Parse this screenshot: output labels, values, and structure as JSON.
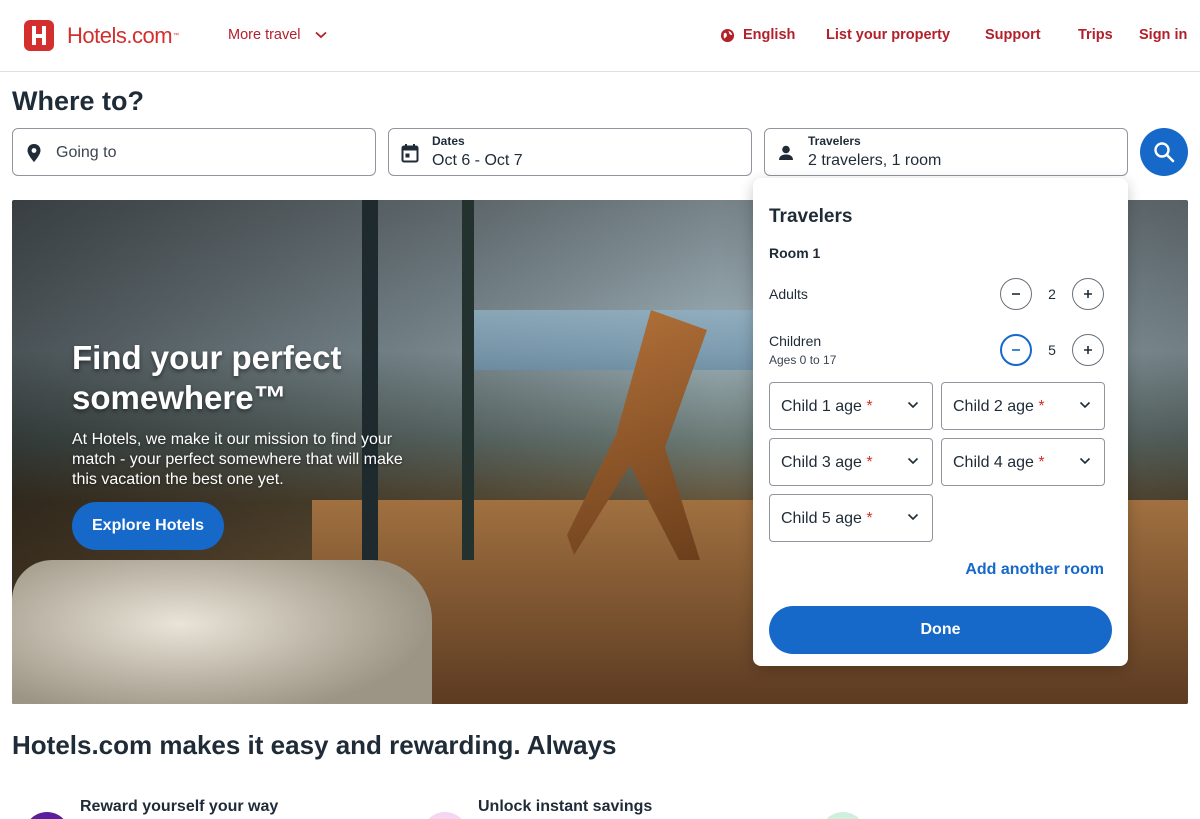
{
  "header": {
    "logo_text": "Hotels.com",
    "logo_tm": "™",
    "more_travel": "More travel",
    "language": "English",
    "list_property": "List your property",
    "support": "Support",
    "trips": "Trips",
    "sign_in": "Sign in"
  },
  "search": {
    "heading": "Where to?",
    "going_to_placeholder": "Going to",
    "dates_label": "Dates",
    "dates_value": "Oct 6 - Oct 7",
    "travelers_label": "Travelers",
    "travelers_value": "2 travelers, 1 room"
  },
  "hero": {
    "title": "Find your perfect somewhere™",
    "description": "At Hotels, we make it our mission to find your match - your perfect somewhere that will make this vacation the best one yet.",
    "button": "Explore Hotels"
  },
  "travelers_popup": {
    "title": "Travelers",
    "room_label": "Room 1",
    "adults_label": "Adults",
    "adults_count": "2",
    "children_label": "Children",
    "children_sublabel": "Ages 0 to 17",
    "children_count": "5",
    "child_ages": [
      {
        "label": "Child 1 age",
        "required": "*"
      },
      {
        "label": "Child 2 age",
        "required": "*"
      },
      {
        "label": "Child 3 age",
        "required": "*"
      },
      {
        "label": "Child 4 age",
        "required": "*"
      },
      {
        "label": "Child 5 age",
        "required": "*"
      }
    ],
    "add_room": "Add another room",
    "done": "Done"
  },
  "benefits": {
    "heading": "Hotels.com makes it easy and rewarding. Always",
    "items": [
      {
        "title": "Reward yourself your way",
        "color": "#5b1f9e"
      },
      {
        "title": "Unlock instant savings",
        "color": "#f4d6f0"
      },
      {
        "title": "",
        "color": "#cfeedc"
      }
    ]
  },
  "colors": {
    "brand_red": "#d32f2f",
    "primary_blue": "#1668c9"
  }
}
